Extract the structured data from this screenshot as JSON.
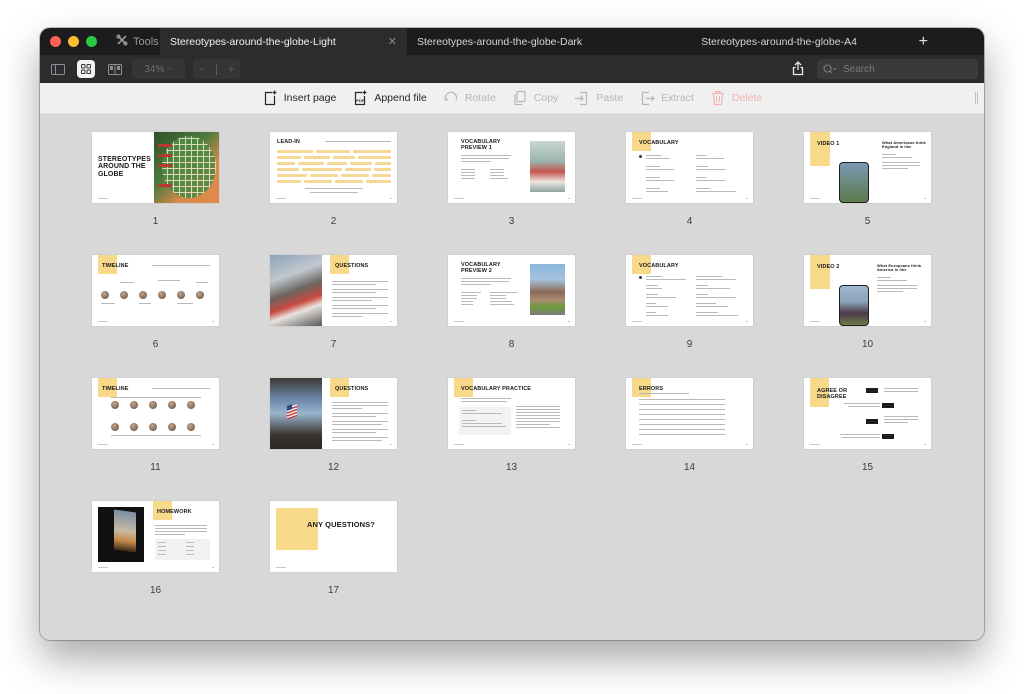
{
  "window": {
    "tabs": {
      "tools_label": "Tools",
      "tools_icon": "tools-icon",
      "items": [
        {
          "label": "Stereotypes-around-the-globe-Light",
          "active": true,
          "closable": true
        },
        {
          "label": "Stereotypes-around-the-globe-Dark",
          "active": false
        },
        {
          "label": "Stereotypes-around-the-globe-A4",
          "active": false
        }
      ],
      "add_label": "+"
    },
    "toolbar": {
      "view_modes": [
        "sidebar-view",
        "grid-view",
        "two-page-view"
      ],
      "active_view": "grid-view",
      "zoom_level": "34%",
      "zoom_out_label": "−",
      "zoom_in_label": "+",
      "search_placeholder": "Search"
    },
    "actions": [
      {
        "label": "Insert page",
        "icon": "insert-page-icon",
        "enabled": true
      },
      {
        "label": "Append file",
        "icon": "append-pdf-icon",
        "enabled": true
      },
      {
        "label": "Rotate",
        "icon": "rotate-icon",
        "enabled": false
      },
      {
        "label": "Copy",
        "icon": "copy-icon",
        "enabled": false
      },
      {
        "label": "Paste",
        "icon": "paste-icon",
        "enabled": false
      },
      {
        "label": "Extract",
        "icon": "extract-icon",
        "enabled": false
      },
      {
        "label": "Delete",
        "icon": "trash-icon",
        "enabled": false
      }
    ]
  },
  "accent_color": "#f8d889",
  "pages": [
    {
      "number": "1",
      "title": "STEREOTYPES AROUND THE GLOBE",
      "layout": "cover"
    },
    {
      "number": "2",
      "title": "LEAD-IN",
      "layout": "leadin"
    },
    {
      "number": "3",
      "title": "VOCABULARY PREVIEW 1",
      "layout": "preview"
    },
    {
      "number": "4",
      "title": "VOCABULARY",
      "layout": "vocab"
    },
    {
      "number": "5",
      "title": "VIDEO 1",
      "subtitle": "What Americans think England is like",
      "layout": "video"
    },
    {
      "number": "6",
      "title": "TIMELINE",
      "layout": "timeline"
    },
    {
      "number": "7",
      "title": "QUESTIONS",
      "layout": "questions"
    },
    {
      "number": "8",
      "title": "VOCABULARY PREVIEW 2",
      "layout": "preview"
    },
    {
      "number": "9",
      "title": "VOCABULARY",
      "layout": "vocab"
    },
    {
      "number": "10",
      "title": "VIDEO 2",
      "subtitle": "What Europeans think America is like",
      "layout": "video"
    },
    {
      "number": "11",
      "title": "TIMELINE",
      "layout": "timeline2"
    },
    {
      "number": "12",
      "title": "QUESTIONS",
      "layout": "questions"
    },
    {
      "number": "13",
      "title": "VOCABULARY PRACTICE",
      "layout": "practice"
    },
    {
      "number": "14",
      "title": "ERRORS",
      "layout": "errors"
    },
    {
      "number": "15",
      "title": "AGREE OR DISAGREE",
      "layout": "agree"
    },
    {
      "number": "16",
      "title": "HOMEWORK",
      "layout": "homework"
    },
    {
      "number": "17",
      "title": "ANY QUESTIONS?",
      "layout": "end"
    }
  ]
}
